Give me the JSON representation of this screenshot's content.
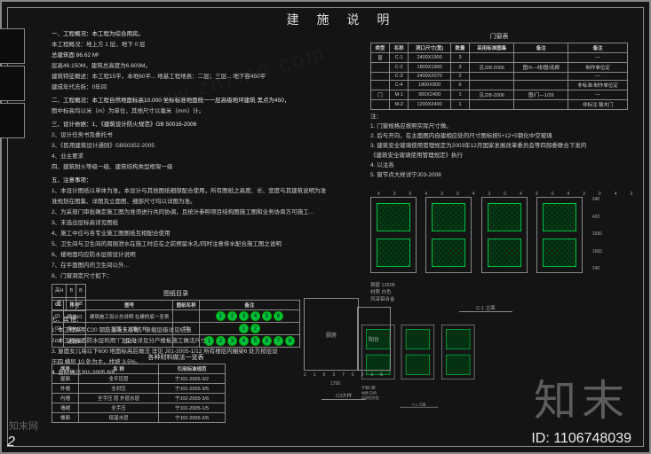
{
  "title": "建 施 说 明",
  "page_number": "2",
  "id_label": "ID: 1106748039",
  "watermark_big": "知末",
  "watermark_small": "知末网",
  "watermark_url": "www.znzmo.com",
  "sections": {
    "s1_head": "一、工程概况：本工程为综合用房。",
    "s1_l1": "本工程概况：地上方 1 层，地下 0 层",
    "s1_area": "总建筑面 86.62 M²",
    "s1_l2": "层高46.150M，建筑总高度为6.600M。",
    "s1_l3": "建筑特征概述：本工程15平，本地80平... 地基工程地表：二层；三层... 地下容450平",
    "s1_l4": "建成年代去拆：0年间",
    "s2_head": "二、工程概况：本工程自然地面标高10.000 坐标标准地面统一一层高级地坪建筑 黑点为450，",
    "s2_l1": "图中标高均以米（m）为单位，其他尺寸以毫米（mm）计。",
    "s3_head": "三、设计依据：1、《建筑设计防火规范》GB 50016-2006",
    "s3_l1a": "2、设计任务书及委托书",
    "s3_l1b": "3、《民用建筑设计通则》GB50352-2005",
    "s3_l1c": "4、业主要求",
    "s3_l2": "四、建筑耐火等级一级、建筑结构类型框架一级",
    "s3_note_head": "五、注意事项：",
    "s3_note_1": "1、本设计图纸以单体为准，本设计与其他图纸细部配合使用，所有图纸之高度、长、宽度与其建筑说明为准",
    "s3_note_2": "   准规划在图集、详图及立面图、细部尺寸均以详图为准。",
    "s3_note_3": "2、为采部门审批确定施工图为准须进行共同协调，且统计参照项目结构图施工图和业务协商方可施工...",
    "s3_note_4": "3、末选出层标高详见图纸",
    "s3_note_5": "4、施工中应与各专业施工图图纸互相配合使用",
    "s3_note_6": "5、卫生间与卫生间的周围泄水在施工时应在之前预留水孔/同时注意排水配合施工图之说明",
    "s3_note_7": "6、楼地面均应防水层按设计说明",
    "s3_note_8": "7、在平面图内的卫生间以外...",
    "s3_note_9": "8、门窗洞定尺寸如下：",
    "s3_table_mini": [
      [
        "高H",
        "B",
        "B"
      ],
      [
        "宽",
        "B",
        "B"
      ]
    ],
    "s7_head": "七、其 他：",
    "s7_l1": "1. 本工程采用C20 钢筋混凝土基础，承载层级详见结施",
    "s7_l2": "2. 本工程屋面防水层利用\"门\"型处详见分户楼板施工做法尺寸",
    "s7_l3": "3. 屋面女儿墙以下600 地面标高后做法 详见 J01-2005-1/12 所有楼层内圈梁6 处方按层设",
    "s7_l3b": "   压四 横层 10 处为主，找坡 3-5%。",
    "s7_l4": "4. 台阶做法J01-2005 8/8"
  },
  "tile_table_title": "图纸目录",
  "tile_table_header": [
    "01",
    "序号",
    "图号",
    "图纸名称",
    "备注"
  ],
  "tile_table_rows": [
    [
      "01",
      "建施01",
      "建筑施工设计总说明 在建的底一至表",
      "",
      "123456"
    ],
    [
      "02",
      "建施02",
      "屋面 女儿墙大样",
      "51",
      "12"
    ],
    [
      "03",
      "建施03",
      "设计 2",
      "",
      "12345678"
    ]
  ],
  "ref_table_title": "各种材料做法一览表",
  "ref_table_header": [
    "序号",
    "名 称",
    "引用标准规范"
  ],
  "ref_table_rows": [
    [
      "屋面",
      "全平压层",
      "宁J01-2005-3/2"
    ],
    [
      "外墙",
      "全封压",
      "宁J01-2005-3/5"
    ],
    [
      "内墙",
      "全手压 层 外层水层",
      "宁J02-2005-3/6"
    ],
    [
      "墙裙",
      "全手压",
      "宁J01-2005-1/5"
    ],
    [
      "楼面",
      "保温水层",
      "宁J02-2005-2/6"
    ]
  ],
  "door_table_title": "门窗表",
  "door_table_header": [
    "类型",
    "名称",
    "洞口尺寸(宽)",
    "数量",
    "采用标准图集",
    "备注",
    "备注"
  ],
  "door_table_rows": [
    [
      "窗",
      "C-1",
      "2400X1900",
      "3",
      "",
      "",
      "—"
    ],
    [
      "",
      "C-2",
      "1800X1900",
      "3",
      "见J28-2006",
      "图/X—线/图/连廊",
      "制作单位定"
    ],
    [
      "",
      "C-3",
      "2400X2070",
      "2",
      "",
      "",
      "—"
    ],
    [
      "",
      "C-4",
      "1800X900",
      "6",
      "",
      "",
      "非标准:制作单位定"
    ],
    [
      "门",
      "M-1",
      "900X2400",
      "1",
      "见J28-2006",
      "图/门—1/26",
      "—"
    ],
    [
      "",
      "M-2",
      "1200X2400",
      "1",
      "",
      "",
      "非标注:钢木门"
    ]
  ],
  "right_notes_head": "注：",
  "right_notes": [
    "1. 门窗规格应按照实际尺寸做。",
    "2. 后与开向，在主面图内自建相应处的尺寸图标按5+12+5钢化中空玻璃",
    "3. 建筑安全玻璃使用管理规定为2003年12月国家发展改革委员会等四部委联合下发的",
    "   《建筑安全玻璃使用管理规定》执行",
    "4. 以注各",
    "5. 窗节点大样详宁J03-2008"
  ],
  "elev1_label": "C-1 立面",
  "elev2_label": "C-2 立面",
  "elev_sublabel1": "钢窗 12505",
  "elev_sublabel2": "材质 白色",
  "elev_sublabel3": "风采铝合金",
  "elev_sublabel4": "开窗口数",
  "dims1": [
    "430",
    "430",
    "430",
    "430",
    "430",
    "430"
  ],
  "dims_h": [
    "240",
    "420",
    "1050",
    "1560",
    "240"
  ],
  "plan_title": "C3大样",
  "plan_room_a": "厨房",
  "plan_room_b": "阳台",
  "plan_dims": [
    "215",
    "375",
    "215"
  ],
  "plan_dim_total": "1750"
}
